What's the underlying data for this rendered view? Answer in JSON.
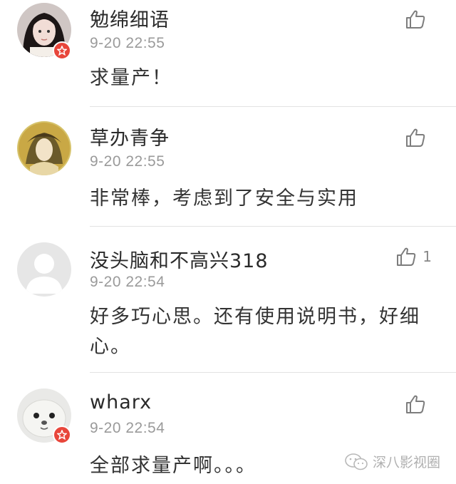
{
  "comments": [
    {
      "name": "勉绵细语",
      "time": "9-20 22:55",
      "text": "求量产！",
      "likes": ""
    },
    {
      "name": "草办青争",
      "time": "9-20 22:55",
      "text": "非常棒，考虑到了安全与实用",
      "likes": ""
    },
    {
      "name": "没头脑和不高兴318",
      "time": "9-20 22:54",
      "text": "好多巧心思。还有使用说明书，好细心。",
      "likes": "1"
    },
    {
      "name": "wharx",
      "time": "9-20 22:54",
      "text": "全部求量产啊。。。",
      "likes": ""
    }
  ],
  "watermark": {
    "label": "深八影视圈"
  },
  "colors": {
    "badge": "#e8463b",
    "divider": "#e3e3e3",
    "meta": "#9a9a9a"
  }
}
